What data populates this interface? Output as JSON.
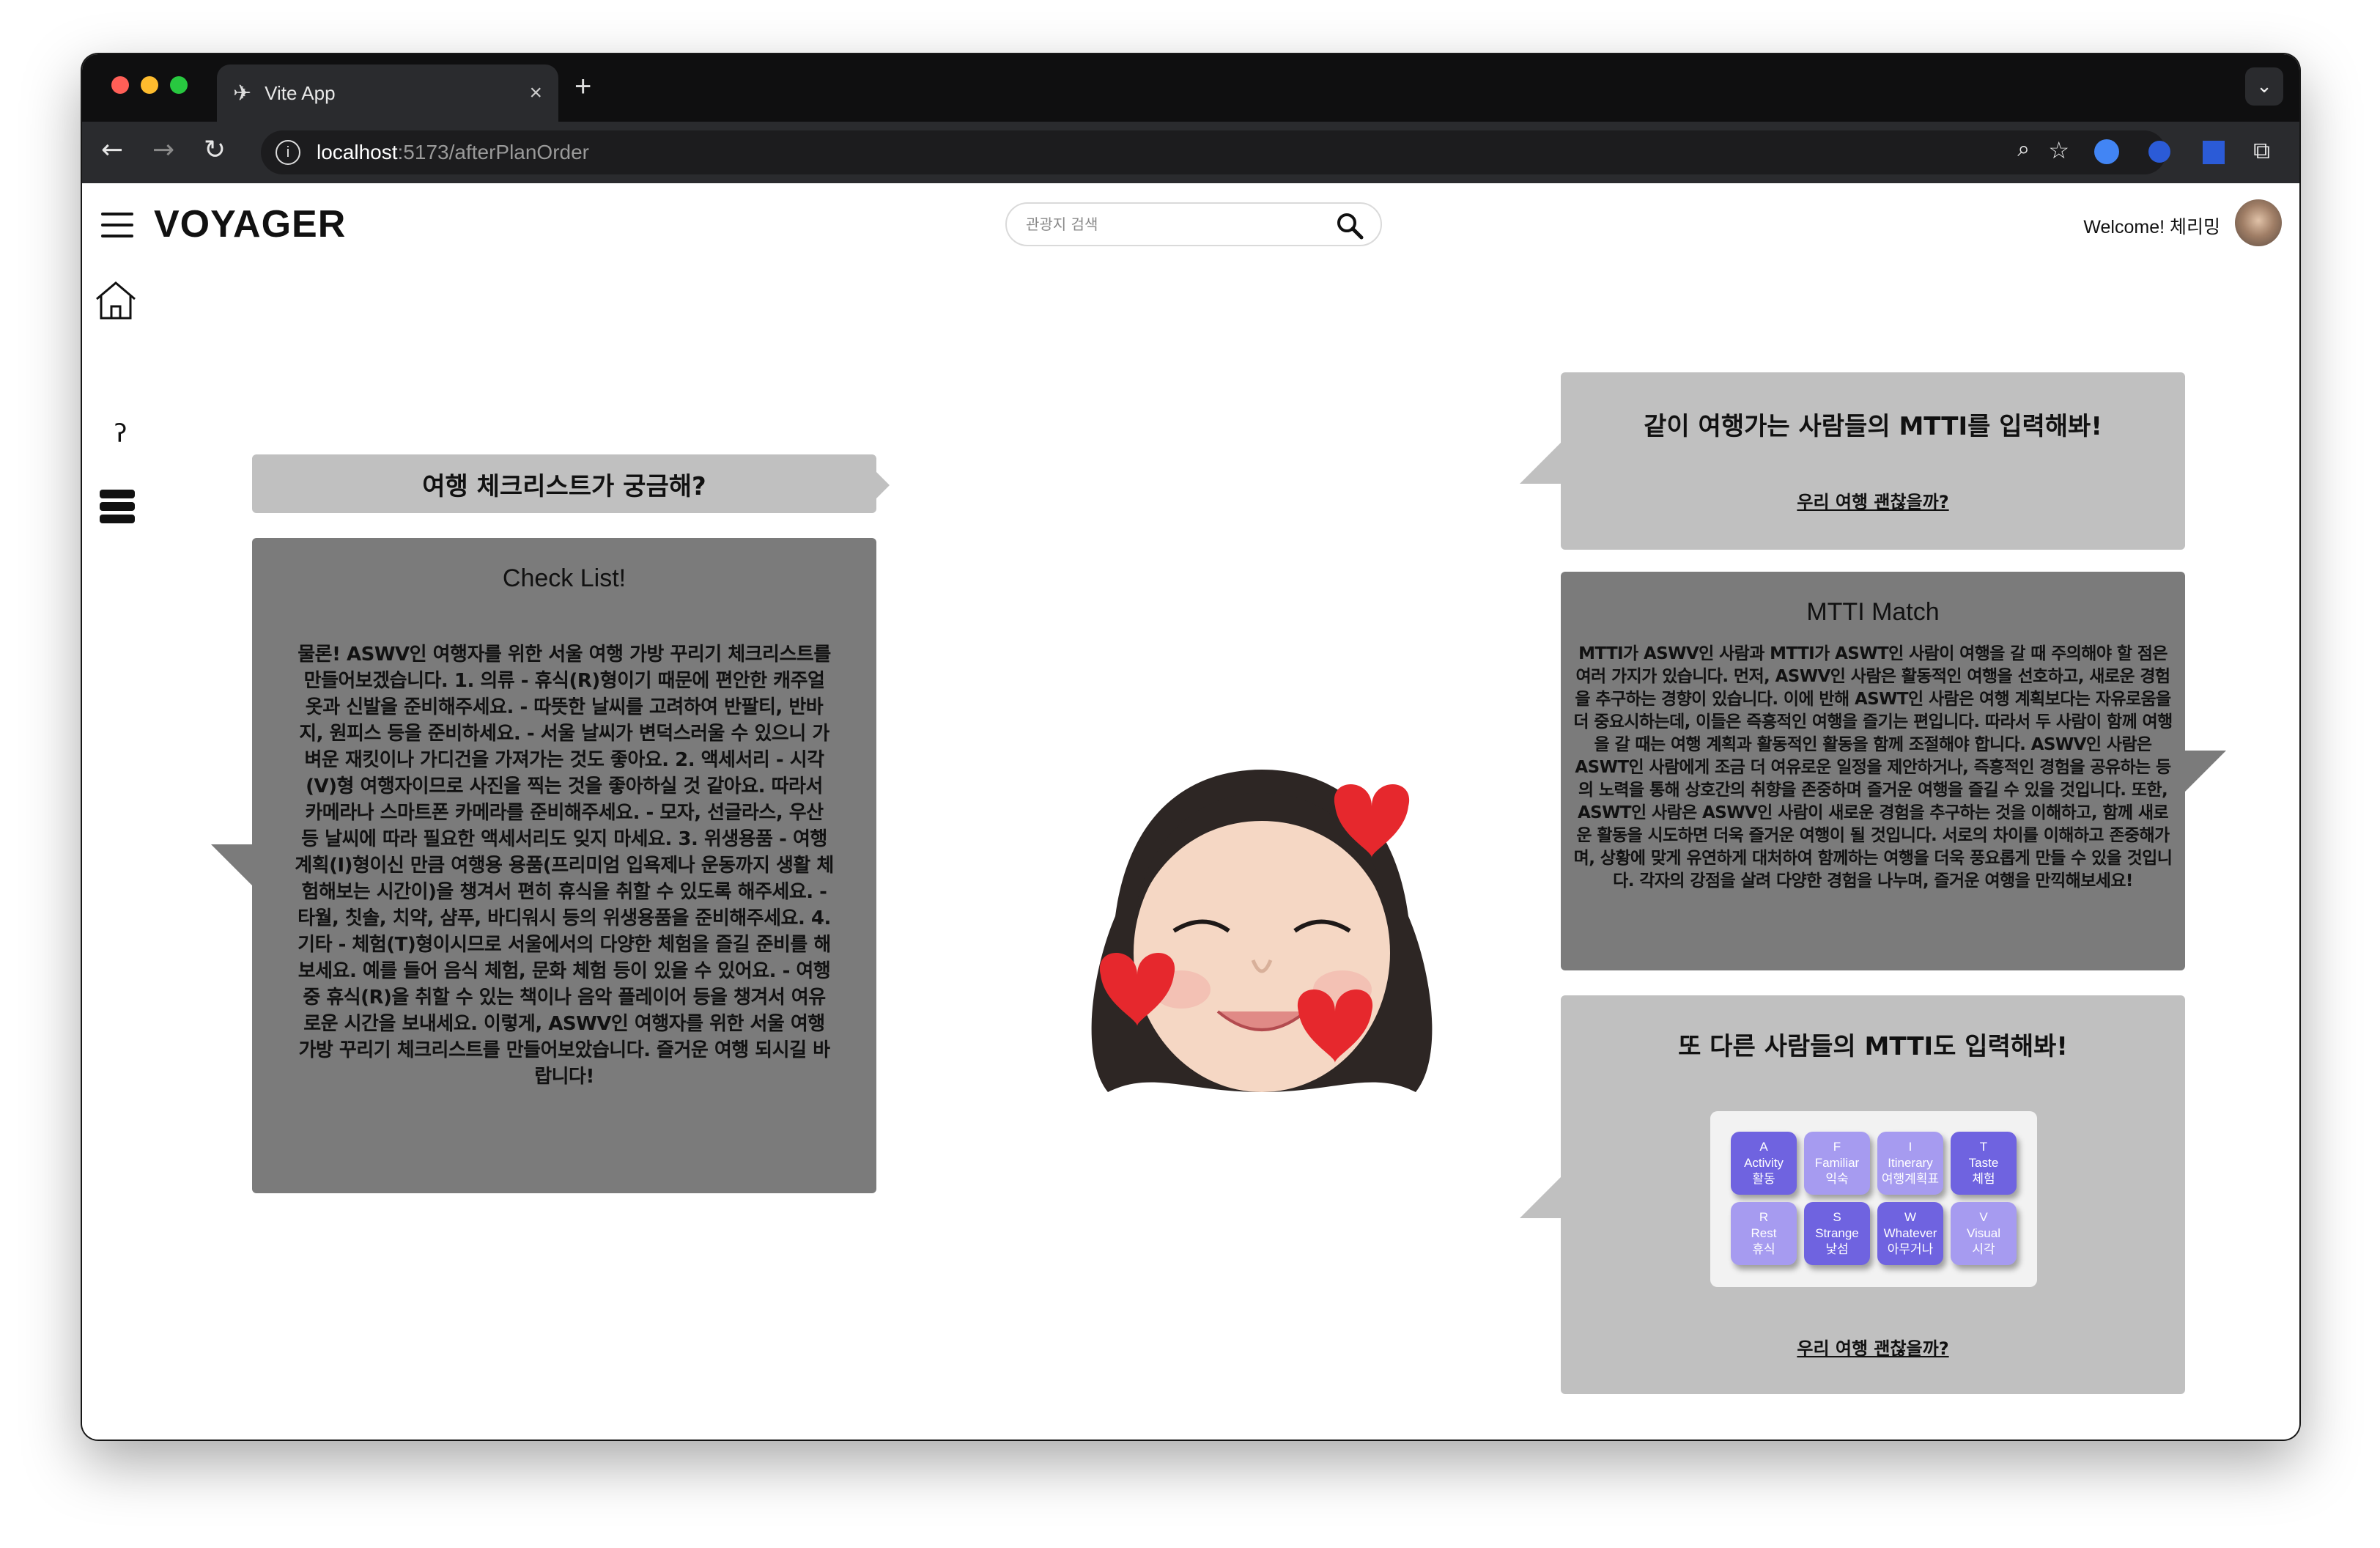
{
  "browser": {
    "tab_title": "Vite App",
    "url_host": "localhost",
    "url_path": ":5173/afterPlanOrder",
    "new_tab_label": "+",
    "tab_close_label": "×"
  },
  "header": {
    "brand": "VOYAGER",
    "search_placeholder": "관광지 검색",
    "welcome": "Welcome! 체리밍"
  },
  "left": {
    "question": "여행 체크리스트가 궁금해?",
    "checklist_title": "Check List!",
    "checklist_body": "물론! ASWV인 여행자를 위한 서울 여행 가방 꾸리기 체크리스트를 만들어보겠습니다. 1. 의류 - 휴식(R)형이기 때문에 편안한 캐주얼 옷과 신발을 준비해주세요. - 따뜻한 날씨를 고려하여 반팔티, 반바지, 원피스 등을 준비하세요. - 서울 날씨가 변덕스러울 수 있으니 가벼운 재킷이나 가디건을 가져가는 것도 좋아요. 2. 액세서리 - 시각(V)형 여행자이므로 사진을 찍는 것을 좋아하실 것 같아요. 따라서 카메라나 스마트폰 카메라를 준비해주세요. - 모자, 선글라스, 우산 등 날씨에 따라 필요한 액세서리도 잊지 마세요. 3. 위생용품 - 여행 계획(I)형이신 만큼 여행용 용품(프리미엄 입욕제나 운동까지 생활 체험해보는 시간이)을 챙겨서 편히 휴식을 취할 수 있도록 해주세요. - 타월, 칫솔, 치약, 샴푸, 바디워시 등의 위생용품을 준비해주세요. 4. 기타 - 체험(T)형이시므로 서울에서의 다양한 체험을 즐길 준비를 해보세요. 예를 들어 음식 체험, 문화 체험 등이 있을 수 있어요. - 여행 중 휴식(R)을 취할 수 있는 책이나 음악 플레이어 등을 챙겨서 여유로운 시간을 보내세요. 이렇게, ASWV인 여행자를 위한 서울 여행 가방 꾸리기 체크리스트를 만들어보았습니다. 즐거운 여행 되시길 바랍니다!"
  },
  "right": {
    "r1_title": "같이 여행가는 사람들의 MTTI를 입력해봐!",
    "r1_link": "우리 여행 괜찮을까?",
    "match_title": "MTTI Match",
    "match_body": "MTTI가 ASWV인 사람과 MTTI가 ASWT인 사람이 여행을 갈 때 주의해야 할 점은 여러 가지가 있습니다. 먼저, ASWV인 사람은 활동적인 여행을 선호하고, 새로운 경험을 추구하는 경향이 있습니다. 이에 반해 ASWT인 사람은 여행 계획보다는 자유로움을 더 중요시하는데, 이들은 즉흥적인 여행을 즐기는 편입니다. 따라서 두 사람이 함께 여행을 갈 때는 여행 계획과 활동적인 활동을 함께 조절해야 합니다. ASWV인 사람은 ASWT인 사람에게 조금 더 여유로운 일정을 제안하거나, 즉흥적인 경험을 공유하는 등의 노력을 통해 상호간의 취향을 존중하며 즐거운 여행을 즐길 수 있을 것입니다. 또한, ASWT인 사람은 ASWV인 사람이 새로운 경험을 추구하는 것을 이해하고, 함께 새로운 활동을 시도하면 더욱 즐거운 여행이 될 것입니다. 서로의 차이를 이해하고 존중해가며, 상황에 맞게 유연하게 대처하여 함께하는 여행을 더욱 풍요롭게 만들 수 있을 것입니다. 각자의 강점을 살려 다양한 경험을 나누며, 즐거운 여행을 만끽해보세요!",
    "r3_title": "또 다른 사람들의 MTTI도 입력해봐!",
    "r3_link": "우리 여행 괜찮을까?",
    "keys": [
      {
        "letter": "A",
        "en": "Activity",
        "ko": "활동",
        "tone": "dark"
      },
      {
        "letter": "F",
        "en": "Familiar",
        "ko": "익숙",
        "tone": "light"
      },
      {
        "letter": "I",
        "en": "Itinerary",
        "ko": "여행계획표",
        "tone": "light"
      },
      {
        "letter": "T",
        "en": "Taste",
        "ko": "체험",
        "tone": "dark"
      },
      {
        "letter": "R",
        "en": "Rest",
        "ko": "휴식",
        "tone": "light"
      },
      {
        "letter": "S",
        "en": "Strange",
        "ko": "낯섬",
        "tone": "dark"
      },
      {
        "letter": "W",
        "en": "Whatever",
        "ko": "아무거나",
        "tone": "dark"
      },
      {
        "letter": "V",
        "en": "Visual",
        "ko": "시각",
        "tone": "light"
      }
    ]
  },
  "scroll_down_label": "∨"
}
